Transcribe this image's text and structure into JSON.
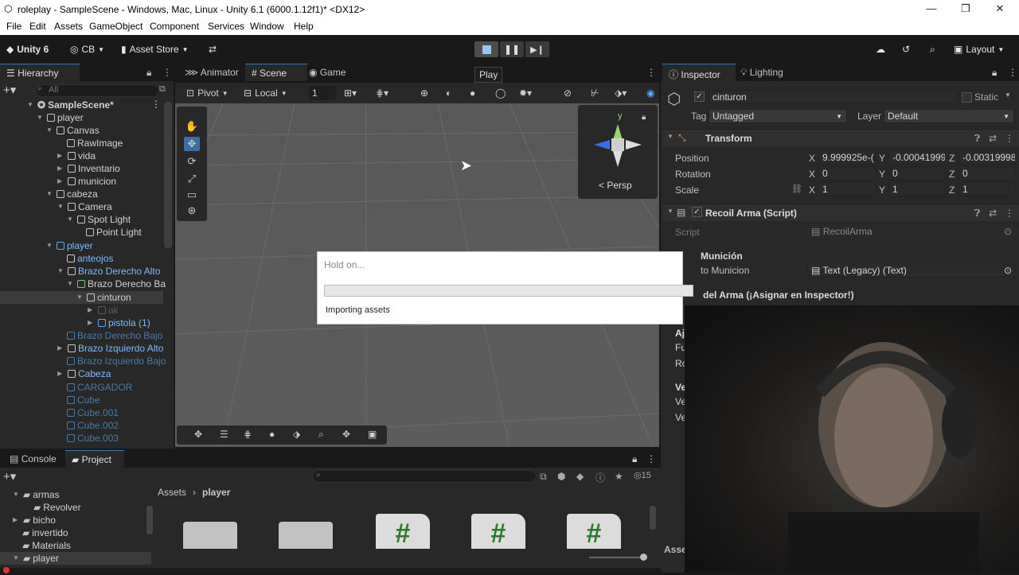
{
  "window": {
    "title": "roleplay - SampleScene - Windows, Mac, Linux - Unity 6.1 (6000.1.12f1)* <DX12>"
  },
  "menu": [
    "File",
    "Edit",
    "Assets",
    "GameObject",
    "Component",
    "Services",
    "Window",
    "Help"
  ],
  "toolbar": {
    "unity": "Unity 6",
    "account": "CB",
    "asset_store": "Asset Store",
    "play_tooltip": "Play",
    "layout": "Layout"
  },
  "hierarchy": {
    "tab": "Hierarchy",
    "search_placeholder": "All",
    "rows": [
      {
        "label": "SampleScene*"
      },
      {
        "label": "player"
      },
      {
        "label": "Canvas"
      },
      {
        "label": "RawImage"
      },
      {
        "label": "vida"
      },
      {
        "label": "Inventario"
      },
      {
        "label": "municion"
      },
      {
        "label": "cabeza"
      },
      {
        "label": "Camera"
      },
      {
        "label": "Spot Light"
      },
      {
        "label": "Point Light"
      },
      {
        "label": "player"
      },
      {
        "label": "anteojos"
      },
      {
        "label": "Brazo Derecho Alto"
      },
      {
        "label": "Brazo Derecho Ba"
      },
      {
        "label": "cinturon"
      },
      {
        "label": "ak"
      },
      {
        "label": "pistola (1)"
      },
      {
        "label": "Brazo Derecho Bajo"
      },
      {
        "label": "Brazo Izquierdo Alto"
      },
      {
        "label": "Brazo Izquierdo Bajo"
      },
      {
        "label": "Cabeza"
      },
      {
        "label": "CARGADOR"
      },
      {
        "label": "Cube"
      },
      {
        "label": "Cube.001"
      },
      {
        "label": "Cube.002"
      },
      {
        "label": "Cube.003"
      }
    ]
  },
  "scene_tabs": [
    "Animator",
    "Scene",
    "Game"
  ],
  "scene_toolbar": {
    "pivot": "Pivot",
    "local": "Local",
    "grid_size": "1"
  },
  "gizmo": {
    "persp": "Persp",
    "y_axis": "y"
  },
  "dialog": {
    "title": "Hold on...",
    "message": "Importing assets",
    "progress": 0
  },
  "inspector": {
    "tabs": [
      "Inspector",
      "Lighting"
    ],
    "object_name": "cinturon",
    "static_label": "Static",
    "tag_label": "Tag",
    "tag_value": "Untagged",
    "layer_label": "Layer",
    "layer_value": "Default",
    "transform": {
      "title": "Transform",
      "position_label": "Position",
      "rotation_label": "Rotation",
      "scale_label": "Scale",
      "position": [
        "9.999925e-(",
        "-0.00041999",
        "-0.00319998"
      ],
      "rotation": [
        "0",
        "0",
        "0"
      ],
      "scale": [
        "1",
        "1",
        "1"
      ],
      "axes": [
        "X",
        "Y",
        "Z"
      ]
    },
    "recoil": {
      "title": "Recoil Arma (Script)",
      "script_label": "Script",
      "script_value": "RecoilArma",
      "section_municion": "Munición",
      "texto_label": "to Municion",
      "texto_value": "Text (Legacy) (Text)",
      "section_arma": "del Arma (¡Asignar en Inspector!)",
      "partial_labels": [
        "Aj",
        "Fu",
        "Ro",
        "Ve",
        "Ve",
        "Ve"
      ]
    },
    "footer": "Asse"
  },
  "project": {
    "tabs": [
      "Console",
      "Project"
    ],
    "folders": [
      "armas",
      "Revolver",
      "bicho",
      "invertido",
      "Materials",
      "player"
    ],
    "breadcrumb": [
      "Assets",
      "player"
    ],
    "count": "15"
  }
}
